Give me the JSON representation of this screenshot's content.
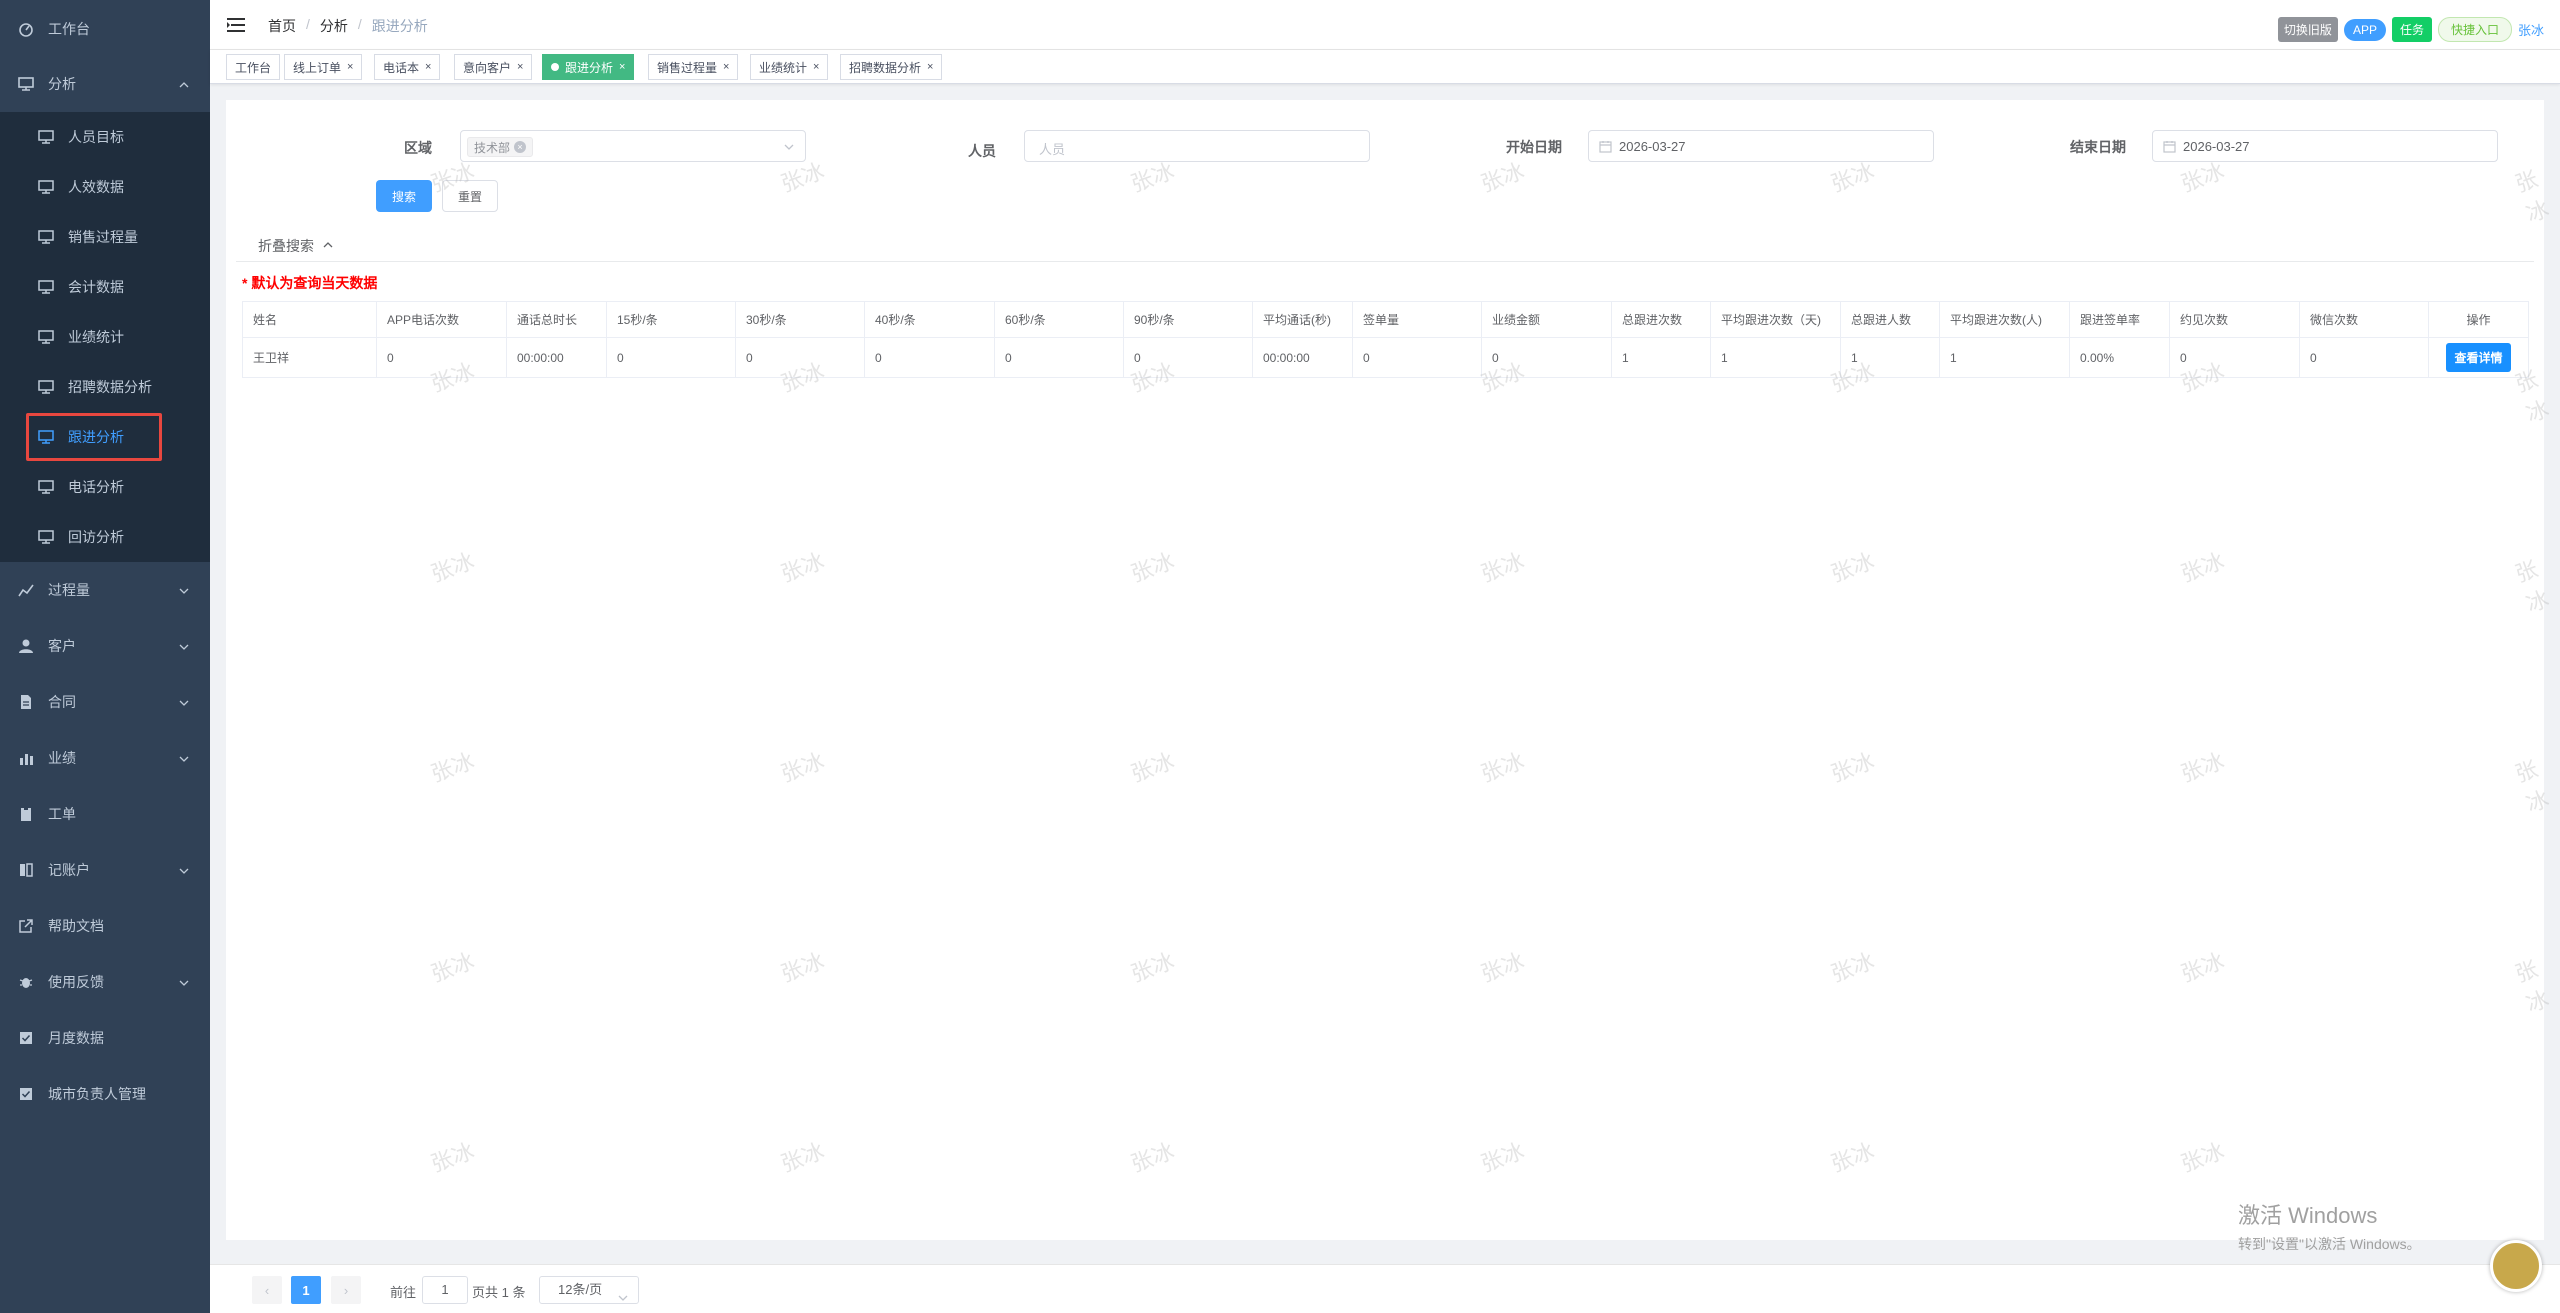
{
  "sidebar": {
    "items": [
      {
        "label": "工作台",
        "icon": "dashboard-icon"
      },
      {
        "label": "分析",
        "icon": "monitor-icon",
        "expanded": true
      },
      {
        "label": "过程量",
        "icon": "chart-icon"
      },
      {
        "label": "客户",
        "icon": "user-icon"
      },
      {
        "label": "合同",
        "icon": "document-icon"
      },
      {
        "label": "业绩",
        "icon": "bar-chart-icon"
      },
      {
        "label": "工单",
        "icon": "clipboard-icon"
      },
      {
        "label": "记账户",
        "icon": "ledger-icon"
      },
      {
        "label": "帮助文档",
        "icon": "external-link-icon"
      },
      {
        "label": "使用反馈",
        "icon": "bug-icon"
      },
      {
        "label": "月度数据",
        "icon": "check-square-icon"
      },
      {
        "label": "城市负责人管理",
        "icon": "check-square-icon"
      }
    ],
    "sub_items": [
      {
        "label": "人员目标"
      },
      {
        "label": "人效数据"
      },
      {
        "label": "销售过程量"
      },
      {
        "label": "会计数据"
      },
      {
        "label": "业绩统计"
      },
      {
        "label": "招聘数据分析"
      },
      {
        "label": "跟进分析",
        "active": true
      },
      {
        "label": "电话分析"
      },
      {
        "label": "回访分析"
      }
    ]
  },
  "header": {
    "breadcrumb": [
      "首页",
      "分析",
      "跟进分析"
    ],
    "buttons": {
      "old": "切换旧版",
      "app": "APP",
      "task": "任务",
      "quick": "快捷入口"
    },
    "user": "张冰"
  },
  "tags": [
    {
      "label": "工作台"
    },
    {
      "label": "线上订单"
    },
    {
      "label": "电话本"
    },
    {
      "label": "意向客户"
    },
    {
      "label": "跟进分析",
      "active": true
    },
    {
      "label": "销售过程量"
    },
    {
      "label": "业绩统计"
    },
    {
      "label": "招聘数据分析"
    }
  ],
  "filters": {
    "region_label": "区域",
    "region_value": "技术部",
    "person_label": "人员",
    "person_placeholder": "人员",
    "start_label": "开始日期",
    "start_value": "2026-03-27",
    "end_label": "结束日期",
    "end_value": "2026-03-27",
    "search_button": "搜索",
    "reset_button": "重置",
    "collapse_label": "折叠搜索"
  },
  "note": "* 默认为查询当天数据",
  "table": {
    "columns": [
      "姓名",
      "APP电话次数",
      "通话总时长",
      "15秒/条",
      "30秒/条",
      "40秒/条",
      "60秒/条",
      "90秒/条",
      "平均通话(秒)",
      "签单量",
      "业绩金额",
      "总跟进次数",
      "平均跟进次数（天)",
      "总跟进人数",
      "平均跟进次数(人)",
      "跟进签单率",
      "约见次数",
      "微信次数",
      "操作"
    ],
    "rows": [
      [
        "王卫祥",
        "0",
        "00:00:00",
        "0",
        "0",
        "0",
        "0",
        "0",
        "00:00:00",
        "0",
        "0",
        "1",
        "1",
        "1",
        "1",
        "0.00%",
        "0",
        "0"
      ]
    ],
    "action_label": "查看详情"
  },
  "pagination": {
    "current_page": "1",
    "goto_label": "前往",
    "goto_value": "1",
    "total_label": "页共 1 条",
    "page_size": "12条/页"
  },
  "watermark": "张冰",
  "windows_activation": {
    "title": "激活 Windows",
    "subtitle": "转到\"设置\"以激活 Windows。"
  }
}
